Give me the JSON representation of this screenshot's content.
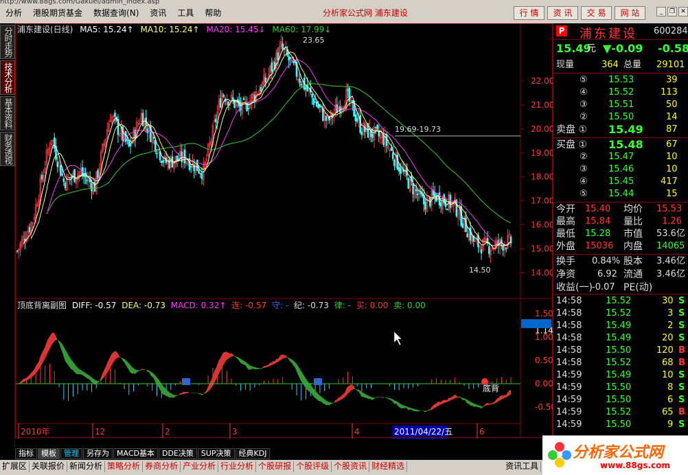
{
  "window": {
    "url": "http://www.88gs.com/Gakuei/admin_index.asp",
    "title": "分析家公式网 浦东建设",
    "menus": [
      "分析",
      "港股期货基金",
      "数据查询(N)",
      "资讯",
      "工具",
      "帮助"
    ],
    "buttons": [
      "行 情",
      "资 讯",
      "交 易",
      "网 站"
    ]
  },
  "left_tabs": [
    "分时走势",
    "技术分析",
    "基本资料",
    "财务透视"
  ],
  "main_chart": {
    "ma_header": {
      "name": "浦东建设(日线)",
      "ma5": "MA5: 15.24↑",
      "ma10": "MA10: 15.24↑",
      "ma20": "MA20: 15.45↓",
      "ma60": "MA60: 17.99↓"
    },
    "annotations": {
      "high": "23.65",
      "level": "19.69-19.73",
      "low": "14.50"
    },
    "indicator_header": {
      "name": "顶底背离副图",
      "diff": "DIFF: -0.57",
      "dea": "DEA: -0.73",
      "macd": "MACD: 0.32↑",
      "lian": "连: -0.57",
      "shou": "守: -",
      "ji": "纪: -0.73",
      "lv": "律: -",
      "buy": "买: 0.00",
      "sell": "卖: 0.00"
    },
    "divergence_label": "底背",
    "price_ticks": [
      "22.00",
      "21.00",
      "20.00",
      "19.00",
      "18.00",
      "17.00",
      "16.00",
      "15.00",
      "14.00"
    ],
    "macd_ticks": [
      "1.50",
      "1.14",
      "1.00",
      "0.50",
      "0.00",
      "-0.50"
    ],
    "time_axis": [
      "2010年",
      "12",
      "2",
      "3",
      "4",
      "6"
    ],
    "cursor_date": "2011/04/22/五",
    "period": "日线"
  },
  "bottom_tabs": [
    "指标",
    "模板",
    "管理",
    "另存为",
    "MACD基本",
    "DDE决策",
    "SUP决策",
    "经典KDJ"
  ],
  "tool_strip": [
    "扩展区",
    "关联报价",
    "新闻分析",
    "策略分析",
    "券商分析",
    "产业分析",
    "行业分析",
    "个股研报",
    "个股评级",
    "个股资讯",
    "财经精选",
    "资讯工具"
  ],
  "logo": {
    "text": "分析家公式网",
    "url": "www.88gs.com"
  },
  "quote": {
    "badge": "P",
    "name": "浦东建设",
    "code": "600284",
    "price": "15.49",
    "price_unit": "元",
    "change": "▼-0.09",
    "change_pct": "-0.58",
    "vol_label": "现量",
    "vol": "364",
    "total_label": "总量",
    "total": "29101",
    "sell_levels": [
      {
        "label": "⑤",
        "price": "15.53",
        "vol": "39"
      },
      {
        "label": "④",
        "price": "15.52",
        "vol": "113"
      },
      {
        "label": "③",
        "price": "15.51",
        "vol": "50"
      },
      {
        "label": "②",
        "price": "15.50",
        "vol": "14"
      },
      {
        "label": "卖盘 ①",
        "price": "15.49",
        "vol": "87"
      }
    ],
    "buy_levels": [
      {
        "label": "买盘 ①",
        "price": "15.48",
        "vol": "67"
      },
      {
        "label": "②",
        "price": "15.47",
        "vol": "10"
      },
      {
        "label": "③",
        "price": "15.46",
        "vol": "10"
      },
      {
        "label": "④",
        "price": "15.45",
        "vol": "417"
      },
      {
        "label": "⑤",
        "price": "15.44",
        "vol": "15"
      }
    ],
    "stats": [
      {
        "l1": "今开",
        "v1": "15.40",
        "c1": "r",
        "l2": "均价",
        "v2": "15.53",
        "c2": "r"
      },
      {
        "l1": "最高",
        "v1": "15.84",
        "c1": "r",
        "l2": "量比",
        "v2": "1.26",
        "c2": "r"
      },
      {
        "l1": "最低",
        "v1": "15.28",
        "c1": "g",
        "l2": "市值",
        "v2": "53.6亿",
        "c2": "w"
      },
      {
        "l1": "外盘",
        "v1": "15036",
        "c1": "r",
        "l2": "内盘",
        "v2": "14065",
        "c2": "g"
      }
    ],
    "stats2": [
      {
        "l1": "换手",
        "v1": "0.84%",
        "l2": "股本",
        "v2": "3.46亿"
      },
      {
        "l1": "净资",
        "v1": "6.92",
        "l2": "流通",
        "v2": "3.46亿"
      },
      {
        "l1": "收益(一)",
        "v1": "-0.07",
        "l2": "PE(动)",
        "v2": ""
      }
    ],
    "ticks": [
      {
        "t": "14:58",
        "p": "15.52",
        "v": "30",
        "s": "S"
      },
      {
        "t": "14:58",
        "p": "15.52",
        "v": "3",
        "s": "S"
      },
      {
        "t": "14:58",
        "p": "15.49",
        "v": "2",
        "s": "S"
      },
      {
        "t": "14:58",
        "p": "15.49",
        "v": "20",
        "s": "S"
      },
      {
        "t": "14:58",
        "p": "15.50",
        "v": "120",
        "s": "B"
      },
      {
        "t": "14:58",
        "p": "15.52",
        "v": "68",
        "s": "B"
      },
      {
        "t": "14:59",
        "p": "15.49",
        "v": "10",
        "s": "S"
      },
      {
        "t": "14:59",
        "p": "15.50",
        "v": "8",
        "s": "S"
      },
      {
        "t": "14:59",
        "p": "15.50",
        "v": "6",
        "s": "S"
      },
      {
        "t": "14:59",
        "p": "15.52",
        "v": "65",
        "s": "B"
      },
      {
        "t": "14:59",
        "p": "15.50",
        "v": "9",
        "s": "S"
      }
    ]
  },
  "colors": {
    "up": "#ff3333",
    "down": "#33ffff",
    "ma5": "#ffffff",
    "ma10": "#ffff66",
    "ma20": "#ff33ff",
    "ma60": "#33cc33",
    "frame": "#880000"
  }
}
